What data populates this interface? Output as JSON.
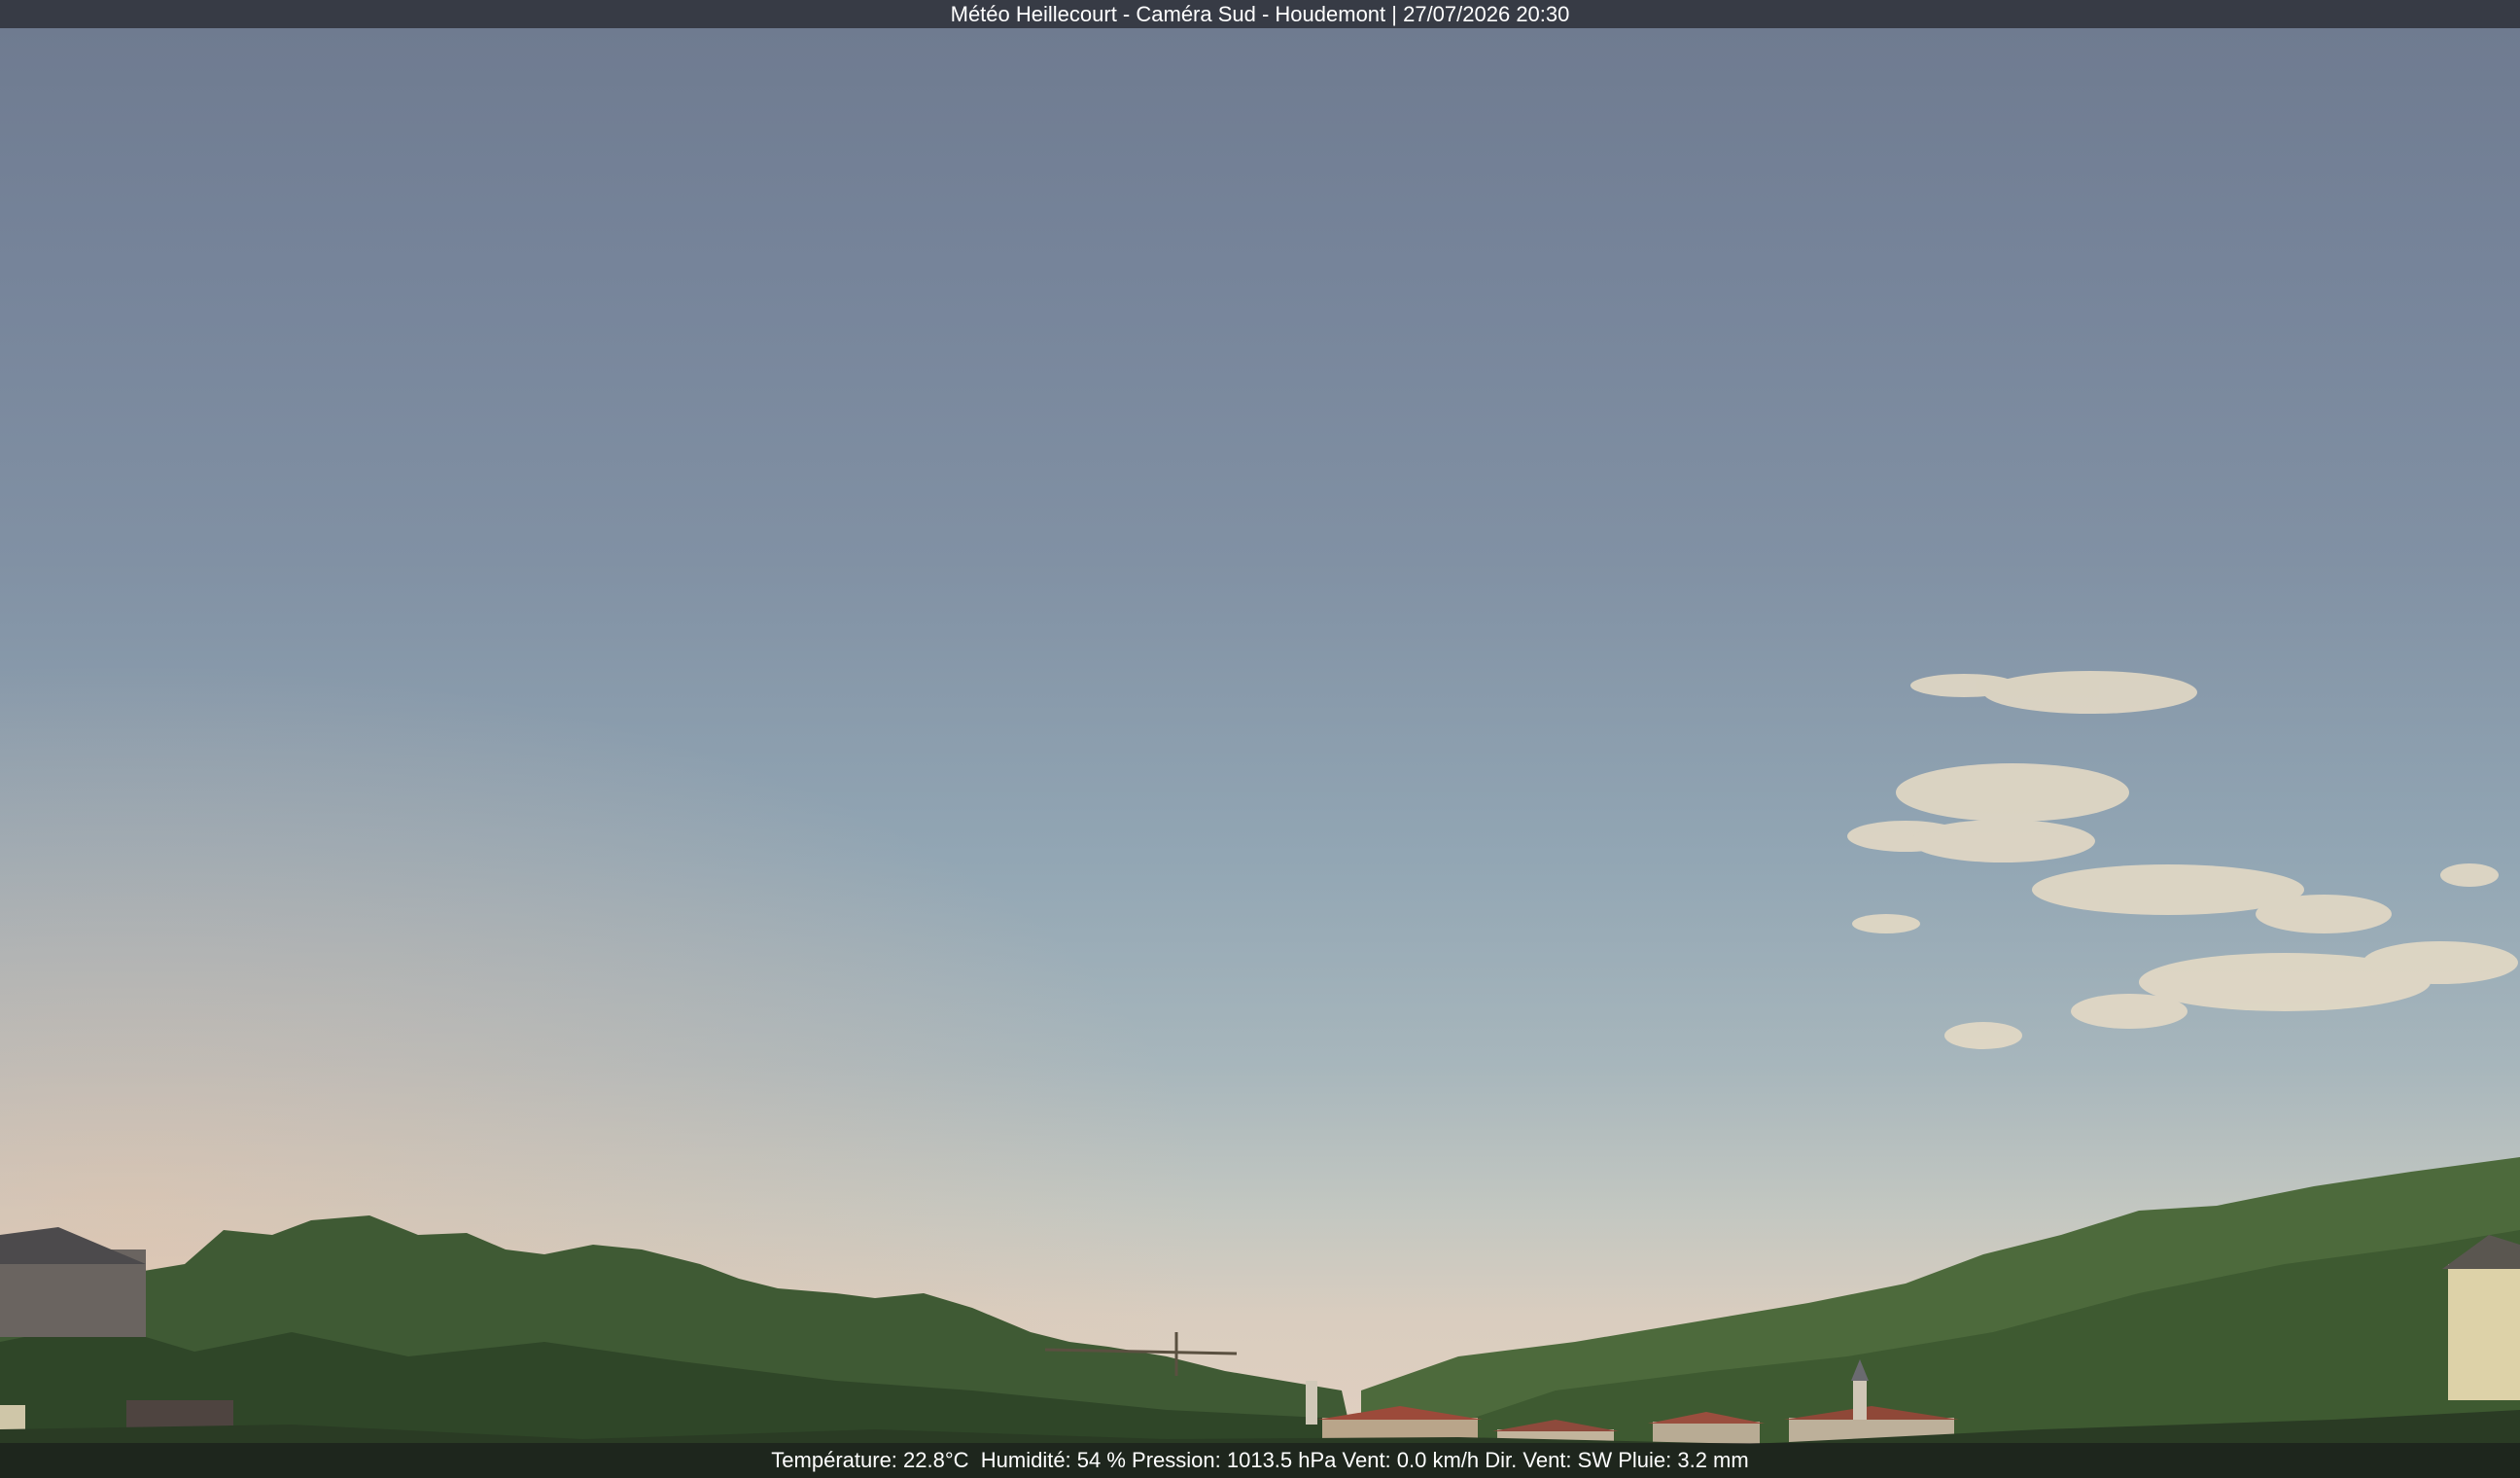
{
  "header": {
    "title": "Météo Heillecourt - Caméra Sud - Houdemont | 27/07/2026 20:30"
  },
  "status": {
    "line": "Température: 22.8°C  Humidité: 54 % Pression: 1013.5 hPa Vent: 0.0 km/h Dir. Vent: SW Pluie: 3.2 mm"
  },
  "colors": {
    "sky_top": "#6e7a8f",
    "sky_horizon": "#e4d0c0",
    "foliage": "#3f5a34",
    "title_bar": "#373b45"
  }
}
